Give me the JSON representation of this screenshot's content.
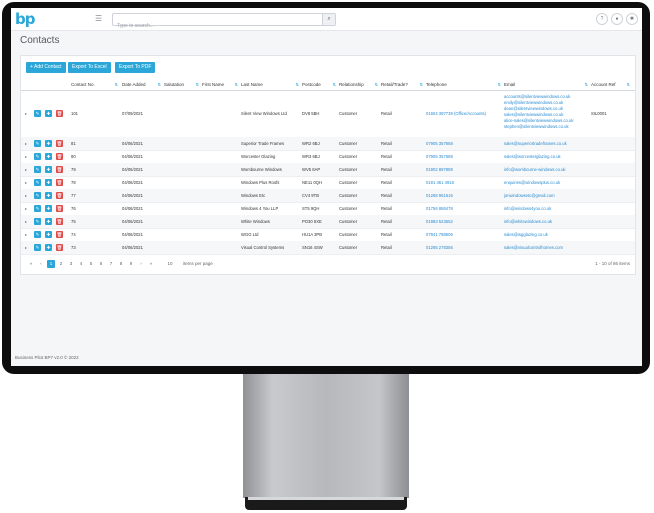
{
  "topbar": {
    "logo": "bp",
    "menu_icon": "hamburger-icon",
    "search_placeholder": "Type to search...",
    "search_icon": "search-icon",
    "icons": [
      "help-icon",
      "user-icon",
      "settings-icon"
    ]
  },
  "page": {
    "title": "Contacts"
  },
  "toolbar": {
    "add_label": "+ Add Contact",
    "excel_label": "Export To Excel",
    "pdf_label": "Export To PDF"
  },
  "table": {
    "columns": [
      "Contact No.",
      "Date Added",
      "Salutation",
      "First Name",
      "Last Name",
      "Postcode",
      "Relationship",
      "Retail/Trade?",
      "Telephone",
      "Email",
      "Account Ref"
    ],
    "rows": [
      {
        "no": "101",
        "date": "07/09/2021",
        "sal": "",
        "first": "",
        "last": "Silent View Windows Ltd",
        "postcode": "DV8 5BH",
        "rel": "Customer",
        "retail": "Retail",
        "tel": "01604 397739 (Office/Accounts)",
        "email": [
          "accounts@silentviewwindows.co.uk",
          "emily@silentviewwindows.co.uk",
          "dean@silentviewwindows.co.uk",
          "sales@silentviewwindows.co.uk",
          "alice-sales@silentviewwindows.co.uk",
          "stephen@silentviewwindows.co.uk"
        ],
        "acc": "SIL0001"
      },
      {
        "no": "81",
        "date": "04/06/2021",
        "sal": "",
        "first": "",
        "last": "Superior Trade Frames",
        "postcode": "WR2 6BJ",
        "rel": "Customer",
        "retail": "Retail",
        "tel": "07905 357668",
        "email": [
          "sales@superiortradeframes.co.uk"
        ],
        "acc": ""
      },
      {
        "no": "80",
        "date": "04/06/2021",
        "sal": "",
        "first": "",
        "last": "Worcester Glazing",
        "postcode": "WR3 6BJ",
        "rel": "Customer",
        "retail": "Retail",
        "tel": "07905 357668",
        "email": [
          "sales@worcesterglazing.co.uk"
        ],
        "acc": ""
      },
      {
        "no": "79",
        "date": "04/06/2021",
        "sal": "",
        "first": "",
        "last": "Wombourne Windows",
        "postcode": "WV5 8AP",
        "rel": "Customer",
        "retail": "Retail",
        "tel": "01902 897889",
        "email": [
          "info@wombourne-windows.co.uk"
        ],
        "acc": ""
      },
      {
        "no": "78",
        "date": "04/06/2021",
        "sal": "",
        "first": "",
        "last": "Windows Plus Roofs",
        "postcode": "NE11 0QH",
        "rel": "Customer",
        "retail": "Retail",
        "tel": "0191 461 4916",
        "email": [
          "enquiries@windowsplus.co.uk"
        ],
        "acc": ""
      },
      {
        "no": "77",
        "date": "04/06/2021",
        "sal": "",
        "first": "",
        "last": "Windows Etc",
        "postcode": "CV4 9TB",
        "rel": "Customer",
        "retail": "Retail",
        "tel": "01268 951616",
        "email": [
          "jonwindowsetc@gmail.com"
        ],
        "acc": ""
      },
      {
        "no": "76",
        "date": "04/06/2021",
        "sal": "",
        "first": "",
        "last": "Windows 4 You LLP",
        "postcode": "ST5 9QH",
        "rel": "Customer",
        "retail": "Retail",
        "tel": "01756 886478",
        "email": [
          "info@windows4you.co.uk"
        ],
        "acc": ""
      },
      {
        "no": "75",
        "date": "04/06/2021",
        "sal": "",
        "first": "",
        "last": "White Windows",
        "postcode": "PO30 5XE",
        "rel": "Customer",
        "retail": "Retail",
        "tel": "01983 523552",
        "email": [
          "info@whitewindows.co.uk"
        ],
        "acc": ""
      },
      {
        "no": "74",
        "date": "04/06/2021",
        "sal": "",
        "first": "",
        "last": "WGG Ltd",
        "postcode": "HU1A 3PB",
        "rel": "Customer",
        "retail": "Retail",
        "tel": "07941 798606",
        "email": [
          "sales@wgglazing.co.uk"
        ],
        "acc": ""
      },
      {
        "no": "73",
        "date": "04/06/2021",
        "sal": "",
        "first": "",
        "last": "Visual Control Systems",
        "postcode": "SN16 4SW",
        "rel": "Customer",
        "retail": "Retail",
        "tel": "01285 278356",
        "email": [
          "sales@visualcontrolhomes.com"
        ],
        "acc": ""
      }
    ]
  },
  "pager": {
    "pages": [
      "«",
      "‹",
      "1",
      "2",
      "3",
      "4",
      "5",
      "6",
      "7",
      "8",
      "9",
      "›",
      "»"
    ],
    "current": "1",
    "page_size": "10",
    "per_page_label": "items per page",
    "summary": "1 - 10 of 86 items"
  },
  "footer": {
    "text": "Business Pilot BP7 v2.0 © 2022"
  },
  "colors": {
    "accent": "#2aa7d8",
    "danger": "#e04b4b",
    "link": "#2a8bd2"
  }
}
